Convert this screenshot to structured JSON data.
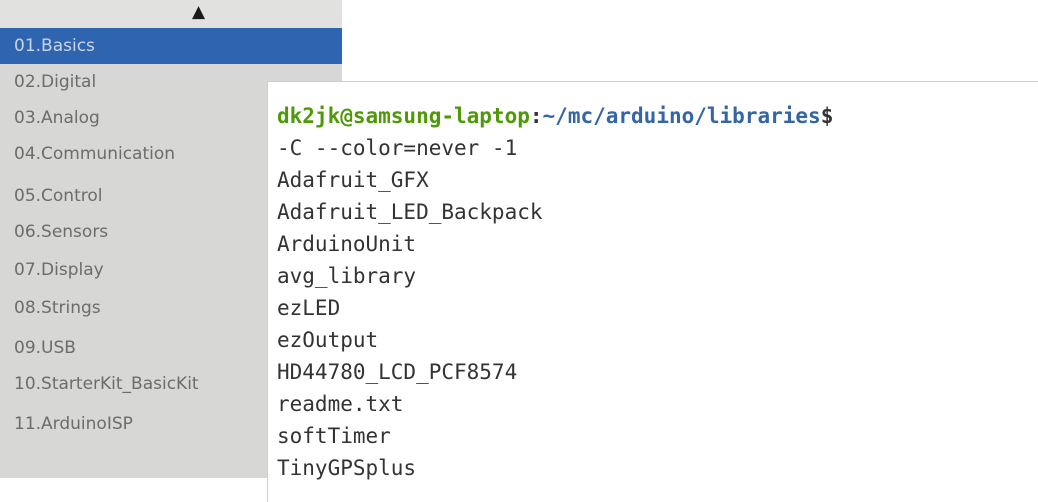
{
  "menu": {
    "scroll_arrow": "▲",
    "items": [
      {
        "label": "01.Basics",
        "selected": true
      },
      {
        "label": "02.Digital"
      },
      {
        "label": "03.Analog"
      },
      {
        "label": "04.Communication"
      },
      {
        "label": "05.Control"
      },
      {
        "label": "06.Sensors"
      },
      {
        "label": "07.Display"
      },
      {
        "label": "08.Strings"
      },
      {
        "label": "09.USB"
      },
      {
        "label": "10.StarterKit_BasicKit"
      },
      {
        "label": "11.ArduinoISP"
      }
    ],
    "colors": {
      "selected_bg": "#2f64b0",
      "bg": "#d7d7d5",
      "text": "#6c6c6c"
    }
  },
  "terminal": {
    "prompt": {
      "user_host": "dk2jk@samsung-laptop",
      "separator": ":",
      "path": "~/mc/arduino/libraries",
      "dollar": "$"
    },
    "lines": [
      "-C --color=never -1",
      "Adafruit_GFX",
      "Adafruit_LED_Backpack",
      "ArduinoUnit",
      "avg_library",
      "ezLED",
      "ezOutput",
      "HD44780_LCD_PCF8574",
      "readme.txt",
      "softTimer",
      "TinyGPSplus"
    ],
    "colors": {
      "user_host": "#4e9a06",
      "path": "#3465a4",
      "text": "#333333"
    }
  }
}
